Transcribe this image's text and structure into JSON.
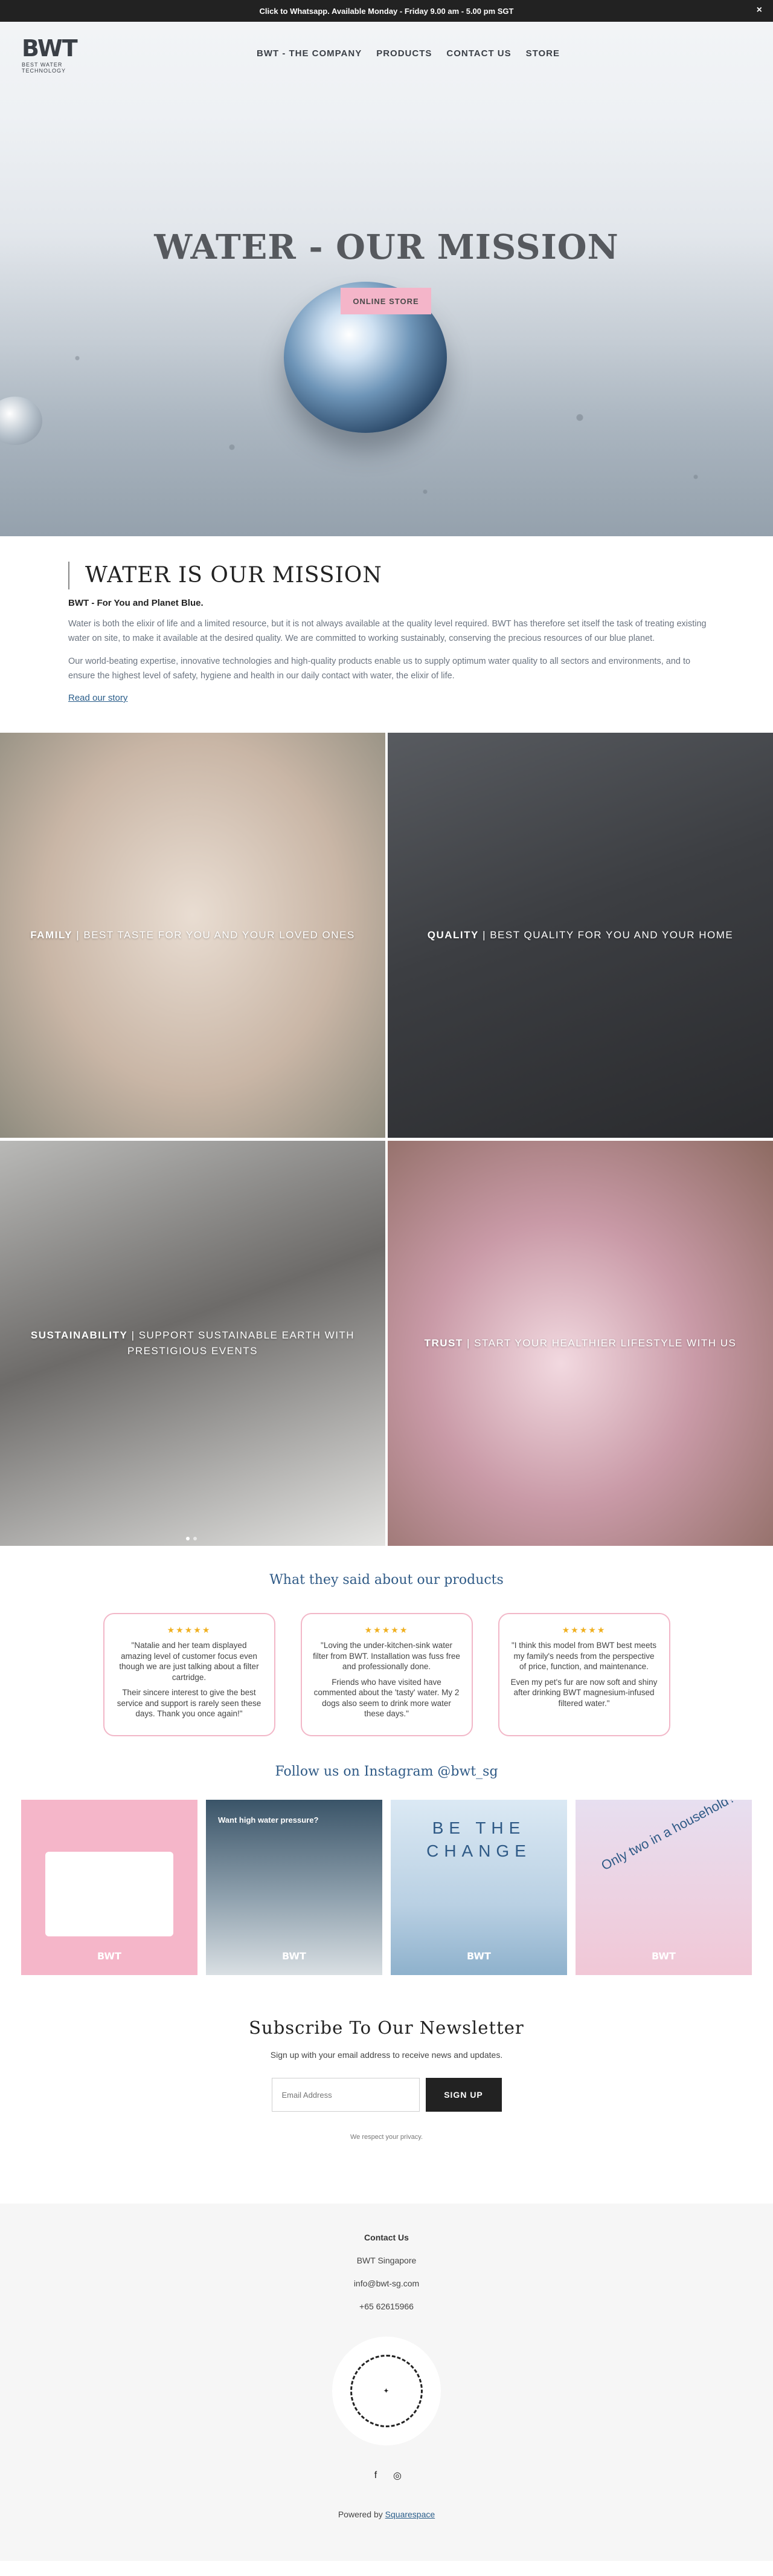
{
  "announcement": {
    "text": "Click to Whatsapp. Available Monday - Friday 9.00 am - 5.00 pm SGT",
    "close": "×"
  },
  "header": {
    "logo_text": "BWT",
    "logo_sub": "BEST WATER TECHNOLOGY",
    "nav": [
      "BWT - THE COMPANY",
      "PRODUCTS",
      "CONTACT US",
      "STORE"
    ]
  },
  "hero": {
    "title": "WATER - OUR MISSION",
    "cta": "ONLINE STORE"
  },
  "mission": {
    "title": "WATER IS OUR MISSION",
    "lead": "BWT - For You and Planet Blue.",
    "p1": "Water is both the elixir of life and a limited resource, but it is not always available at the quality level required. BWT has therefore set itself the task of treating existing water on site, to make it available at the desired quality. We are committed to working sustainably, conserving the precious resources of our blue planet.",
    "p2": "Our world-beating expertise, innovative technologies and high-quality products enable us to supply optimum water quality to all sectors and environments, and to ensure the highest level of safety, hygiene and health in our daily contact with water, the elixir of life.",
    "link": "Read our story"
  },
  "tiles": [
    {
      "bold": "FAMILY",
      "rest": " | BEST TASTE FOR YOU AND YOUR LOVED ONES"
    },
    {
      "bold": "QUALITY",
      "rest": " | BEST QUALITY FOR YOU AND YOUR HOME"
    },
    {
      "bold": "SUSTAINABILITY",
      "rest": " | SUPPORT SUSTAINABLE EARTH WITH PRESTIGIOUS EVENTS"
    },
    {
      "bold": "TRUST",
      "rest": " | START YOUR HEALTHIER LIFESTYLE WITH US"
    }
  ],
  "testimonials": {
    "title": "What they said about our products",
    "stars": "★★★★★",
    "items": [
      {
        "p1": "\"Natalie and her team displayed amazing level of customer focus even though we are just talking about a filter cartridge.",
        "p2": "Their sincere interest to give the best service and support is rarely seen these days. Thank you once again!\""
      },
      {
        "p1": "\"Loving the under-kitchen-sink water filter from BWT. Installation was fuss free and professionally done.",
        "p2": "Friends who have visited have commented about the 'tasty' water. My 2 dogs also seem to drink more water these days.\""
      },
      {
        "p1": "\"I think this model from BWT best meets my family's needs from the perspective of price, function, and maintenance.",
        "p2": "Even my pet's fur are now soft and shiny after drinking BWT magnesium-infused filtered water.\""
      }
    ]
  },
  "instagram": {
    "title": "Follow us on Instagram @bwt_sg",
    "posts": [
      {
        "caption": "BWT"
      },
      {
        "caption": "BWT",
        "headline": "Want high water pressure?"
      },
      {
        "caption": "BWT",
        "headline": "BE THE CHANGE"
      },
      {
        "caption": "BWT",
        "headline": "Only two in a household?"
      }
    ]
  },
  "newsletter": {
    "title": "Subscribe To Our Newsletter",
    "subtitle": "Sign up with your email address to receive news and updates.",
    "placeholder": "Email Address",
    "button": "SIGN UP",
    "privacy": "We respect your privacy."
  },
  "footer": {
    "heading": "Contact Us",
    "company": "BWT Singapore",
    "email": "info@bwt-sg.com",
    "phone": "+65 62615966",
    "powered_prefix": "Powered by ",
    "powered_link": "Squarespace"
  },
  "colors": {
    "accent_pink": "#f4b5c9",
    "link_blue": "#2f5a86",
    "dark": "#222222"
  }
}
